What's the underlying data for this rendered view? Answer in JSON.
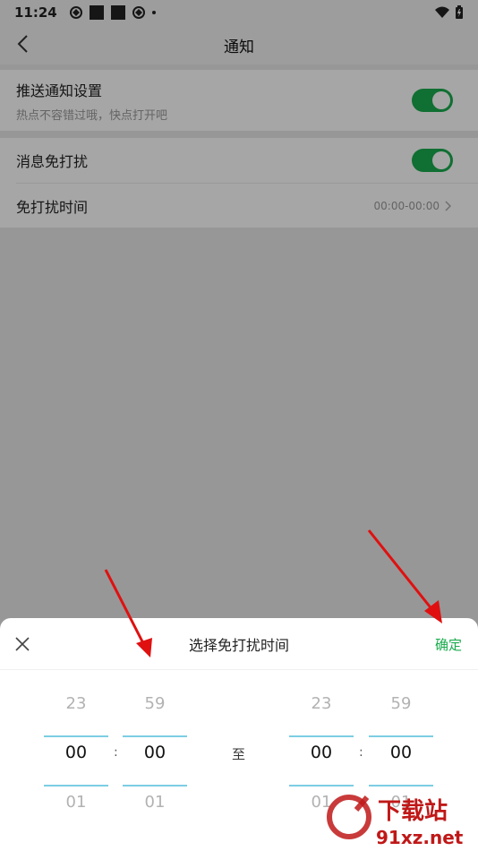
{
  "status_bar": {
    "time": "11:24"
  },
  "header": {
    "title": "通知"
  },
  "settings": {
    "push": {
      "label": "推送通知设置",
      "sub": "热点不容错过哦，快点打开吧",
      "enabled": true
    },
    "dnd": {
      "label": "消息免打扰",
      "enabled": true
    },
    "dnd_time": {
      "label": "免打扰时间",
      "value": "00:00-00:00"
    }
  },
  "sheet": {
    "title": "选择免打扰时间",
    "confirm": "确定",
    "separator": "至",
    "start": {
      "hour_prev": "23",
      "hour": "00",
      "hour_next": "01",
      "min_prev": "59",
      "min": "00",
      "min_next": "01"
    },
    "end": {
      "hour_prev": "23",
      "hour": "00",
      "hour_next": "01",
      "min_prev": "59",
      "min": "00",
      "min_next": "01"
    },
    "colon": ":"
  },
  "watermark": {
    "brand": "下载站",
    "url": "91xz.net"
  },
  "colors": {
    "accent": "#1aab4d",
    "highlight": "#7ccde3",
    "arrow": "#e01010"
  }
}
